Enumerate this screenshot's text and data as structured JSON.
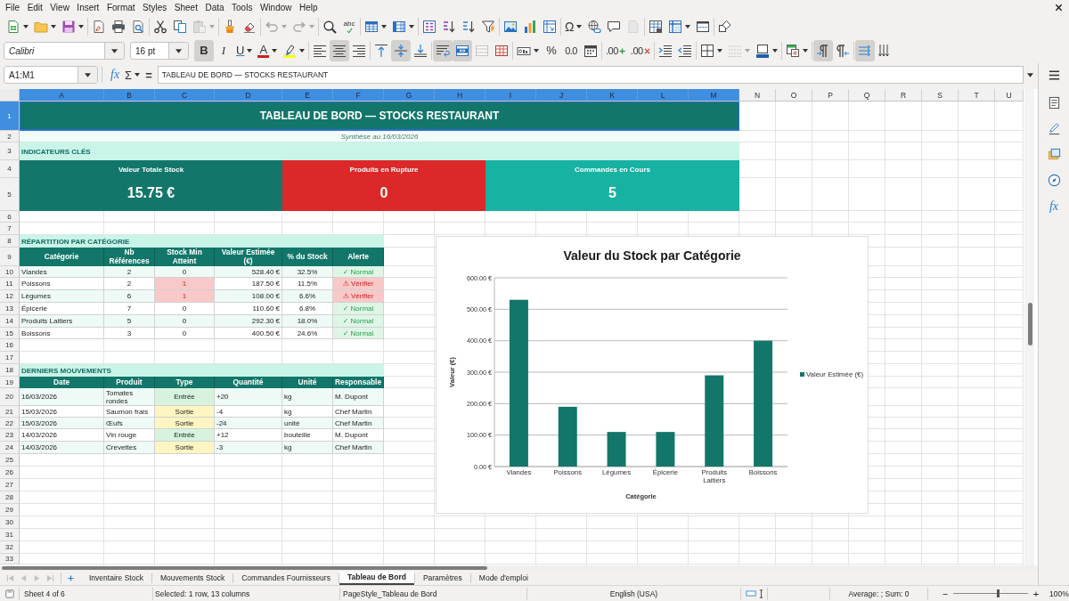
{
  "menu": [
    "File",
    "Edit",
    "View",
    "Insert",
    "Format",
    "Styles",
    "Sheet",
    "Data",
    "Tools",
    "Window",
    "Help"
  ],
  "standard_toolbar": [
    [
      {
        "kind": "new-spreadsheet",
        "dropdown": true,
        "disabled": false
      },
      {
        "kind": "open",
        "dropdown": true,
        "disabled": false
      },
      {
        "kind": "save",
        "dropdown": true,
        "disabled": false
      }
    ],
    [
      {
        "kind": "export-pdf",
        "disabled": false
      },
      {
        "kind": "print",
        "disabled": false
      },
      {
        "kind": "print-preview",
        "disabled": false
      }
    ],
    [
      {
        "kind": "cut",
        "disabled": false
      },
      {
        "kind": "copy",
        "disabled": false
      },
      {
        "kind": "paste",
        "dropdown": true,
        "disabled": true
      }
    ],
    [
      {
        "kind": "clone-formatting",
        "disabled": false
      },
      {
        "kind": "clear-formatting",
        "disabled": false
      }
    ],
    [
      {
        "kind": "undo",
        "dropdown": true,
        "disabled": true
      },
      {
        "kind": "redo",
        "dropdown": true,
        "disabled": true
      }
    ],
    [
      {
        "kind": "find-replace",
        "disabled": false
      },
      {
        "kind": "spelling",
        "label": "abc",
        "disabled": false
      }
    ],
    [
      {
        "kind": "insert-rows",
        "dropdown": true,
        "disabled": false
      },
      {
        "kind": "insert-columns",
        "dropdown": true,
        "disabled": false
      }
    ],
    [
      {
        "kind": "sort",
        "disabled": false
      },
      {
        "kind": "sort-ascending",
        "disabled": false
      },
      {
        "kind": "sort-descending",
        "disabled": false
      },
      {
        "kind": "autofilter",
        "disabled": false
      }
    ],
    [
      {
        "kind": "insert-image",
        "disabled": false
      },
      {
        "kind": "insert-chart",
        "disabled": false
      },
      {
        "kind": "pivot-table",
        "disabled": false
      }
    ],
    [
      {
        "kind": "special-character",
        "label": "Ω",
        "dropdown": true,
        "disabled": false
      },
      {
        "kind": "hyperlink",
        "disabled": false
      },
      {
        "kind": "comment",
        "disabled": false
      },
      {
        "kind": "header-footer",
        "disabled": true
      }
    ],
    [
      {
        "kind": "print-area",
        "disabled": false
      },
      {
        "kind": "freeze-panes",
        "dropdown": true,
        "disabled": false
      },
      {
        "kind": "split-window",
        "disabled": false
      }
    ],
    [
      {
        "kind": "shapes",
        "disabled": false
      }
    ]
  ],
  "format_toolbar": {
    "font_name": "Calibri",
    "font_size": "16 pt",
    "groups": [
      [
        {
          "kind": "bold",
          "label": "B",
          "on": true,
          "disabled": false
        },
        {
          "kind": "italic",
          "label": "I",
          "on": false,
          "disabled": false
        },
        {
          "kind": "underline",
          "label": "U",
          "dropdown": true,
          "on": false,
          "disabled": false
        },
        {
          "kind": "font-color",
          "label": "A",
          "dropdown": true,
          "on": false,
          "disabled": false
        },
        {
          "kind": "highlight",
          "dropdown": true,
          "on": false,
          "disabled": false
        }
      ],
      [
        {
          "kind": "align-left",
          "on": false,
          "disabled": false
        },
        {
          "kind": "align-center",
          "on": true,
          "disabled": false
        },
        {
          "kind": "align-right",
          "on": false,
          "disabled": false
        }
      ],
      [
        {
          "kind": "align-top",
          "on": false,
          "disabled": false
        },
        {
          "kind": "align-middle",
          "on": true,
          "disabled": false
        },
        {
          "kind": "align-bottom",
          "on": false,
          "disabled": false
        }
      ],
      [
        {
          "kind": "wrap-text",
          "on": true,
          "disabled": false
        },
        {
          "kind": "merge-center",
          "on": true,
          "disabled": false
        },
        {
          "kind": "merge-cells",
          "on": false,
          "disabled": true
        },
        {
          "kind": "unmerge-cells",
          "on": false,
          "disabled": false
        }
      ],
      [
        {
          "kind": "currency",
          "dropdown": true,
          "on": false,
          "disabled": false
        },
        {
          "kind": "percent",
          "label": "%",
          "on": false,
          "disabled": false
        },
        {
          "kind": "number",
          "label": "0.0",
          "on": false,
          "disabled": false
        },
        {
          "kind": "date",
          "on": false,
          "disabled": false
        }
      ],
      [
        {
          "kind": "add-decimal",
          "label": ".00",
          "on": false,
          "disabled": false
        },
        {
          "kind": "delete-decimal",
          "label": ".00",
          "on": false,
          "disabled": false
        }
      ],
      [
        {
          "kind": "indent-increase",
          "on": false,
          "disabled": false
        },
        {
          "kind": "indent-decrease",
          "on": false,
          "disabled": false
        }
      ],
      [
        {
          "kind": "borders",
          "dropdown": true,
          "on": false,
          "disabled": false
        },
        {
          "kind": "border-style",
          "dropdown": true,
          "on": false,
          "disabled": true
        },
        {
          "kind": "border-color",
          "dropdown": true,
          "on": false,
          "disabled": false
        }
      ],
      [
        {
          "kind": "conditional",
          "dropdown": true,
          "on": false,
          "disabled": false
        }
      ],
      [
        {
          "kind": "left-to-right",
          "on": true,
          "disabled": false
        },
        {
          "kind": "right-to-left",
          "on": false,
          "disabled": false
        }
      ],
      [
        {
          "kind": "text-left-to-right",
          "on": true,
          "disabled": false
        },
        {
          "kind": "text-top-to-bottom",
          "on": false,
          "disabled": false
        }
      ]
    ]
  },
  "formula_bar": {
    "cell_reference": "A1:M1",
    "function_wizard": "fx",
    "sum": "Σ",
    "equals": "=",
    "content": "TABLEAU DE BORD — STOCKS RESTAURANT"
  },
  "sidebar": [
    {
      "kind": "menu"
    },
    {
      "kind": "properties"
    },
    {
      "kind": "styles"
    },
    {
      "kind": "gallery"
    },
    {
      "kind": "navigator"
    },
    {
      "kind": "functions",
      "label": "fx"
    }
  ],
  "grid": {
    "columns": [
      {
        "label": "A",
        "selected": true
      },
      {
        "label": "B",
        "selected": true
      },
      {
        "label": "C",
        "selected": true
      },
      {
        "label": "D",
        "selected": true
      },
      {
        "label": "E",
        "selected": true
      },
      {
        "label": "F",
        "selected": true
      },
      {
        "label": "G",
        "selected": true
      },
      {
        "label": "H",
        "selected": true
      },
      {
        "label": "I",
        "selected": true
      },
      {
        "label": "J",
        "selected": true
      },
      {
        "label": "K",
        "selected": true
      },
      {
        "label": "L",
        "selected": true
      },
      {
        "label": "M",
        "selected": true
      },
      {
        "label": "N",
        "selected": false
      },
      {
        "label": "O",
        "selected": false
      },
      {
        "label": "P",
        "selected": false
      },
      {
        "label": "Q",
        "selected": false
      },
      {
        "label": "R",
        "selected": false
      },
      {
        "label": "S",
        "selected": false
      },
      {
        "label": "T",
        "selected": false
      },
      {
        "label": "U",
        "selected": false
      }
    ],
    "rows": [
      {
        "label": "1",
        "selected": true
      },
      {
        "label": "2",
        "selected": false
      },
      {
        "label": "3",
        "selected": false
      },
      {
        "label": "4",
        "selected": false
      },
      {
        "label": "5",
        "selected": false
      },
      {
        "label": "6",
        "selected": false
      },
      {
        "label": "7",
        "selected": false
      },
      {
        "label": "8",
        "selected": false
      },
      {
        "label": "9",
        "selected": false
      },
      {
        "label": "10",
        "selected": false
      },
      {
        "label": "11",
        "selected": false
      },
      {
        "label": "12",
        "selected": false
      },
      {
        "label": "13",
        "selected": false
      },
      {
        "label": "14",
        "selected": false
      },
      {
        "label": "15",
        "selected": false
      },
      {
        "label": "16",
        "selected": false
      },
      {
        "label": "17",
        "selected": false
      },
      {
        "label": "18",
        "selected": false
      },
      {
        "label": "19",
        "selected": false
      },
      {
        "label": "20",
        "selected": false
      },
      {
        "label": "21",
        "selected": false
      },
      {
        "label": "22",
        "selected": false
      },
      {
        "label": "23",
        "selected": false
      },
      {
        "label": "24",
        "selected": false
      },
      {
        "label": "25",
        "selected": false
      },
      {
        "label": "26",
        "selected": false
      },
      {
        "label": "27",
        "selected": false
      },
      {
        "label": "28",
        "selected": false
      },
      {
        "label": "29",
        "selected": false
      },
      {
        "label": "30",
        "selected": false
      },
      {
        "label": "31",
        "selected": false
      },
      {
        "label": "32",
        "selected": false
      },
      {
        "label": "33",
        "selected": false
      }
    ]
  },
  "sheet": {
    "title": {
      "text": "TABLEAU DE BORD — STOCKS RESTAURANT",
      "selected": true
    },
    "subtitle": "Synthèse au 16/03/2026",
    "kpi_heading": "INDICATEURS CLÉS",
    "kpis": [
      {
        "label": "Valeur Totale Stock",
        "value": "15.75 €",
        "color": "#13766a"
      },
      {
        "label": "Produits en Rupture",
        "value": "0",
        "color": "#dc2828"
      },
      {
        "label": "Commandes en Cours",
        "value": "5",
        "color": "#17b2a1"
      }
    ],
    "categories": {
      "heading": "RÉPARTITION PAR CATÉGORIE",
      "columns": [
        "Catégorie",
        "Nb Références",
        "Stock Min Atteint",
        "Valeur Estimée (€)",
        "% du Stock",
        "Alerte"
      ],
      "rows": [
        {
          "category": "Viandes",
          "references": "2",
          "stock_min": "0",
          "stock_min_flag": false,
          "value": "528.40 €",
          "share": "32.5%",
          "alert": {
            "kind": "ok",
            "text": "✓ Normal"
          }
        },
        {
          "category": "Poissons",
          "references": "2",
          "stock_min": "1",
          "stock_min_flag": true,
          "value": "187.50 €",
          "share": "11.5%",
          "alert": {
            "kind": "warn",
            "text": "⚠ Vérifier"
          }
        },
        {
          "category": "Légumes",
          "references": "6",
          "stock_min": "1",
          "stock_min_flag": true,
          "value": "108.00 €",
          "share": "6.6%",
          "alert": {
            "kind": "warn",
            "text": "⚠ Vérifier"
          }
        },
        {
          "category": "Épicerie",
          "references": "7",
          "stock_min": "0",
          "stock_min_flag": false,
          "value": "110.60 €",
          "share": "6.8%",
          "alert": {
            "kind": "ok",
            "text": "✓ Normal"
          }
        },
        {
          "category": "Produits Laitiers",
          "references": "5",
          "stock_min": "0",
          "stock_min_flag": false,
          "value": "292.30 €",
          "share": "18.0%",
          "alert": {
            "kind": "ok",
            "text": "✓ Normal"
          }
        },
        {
          "category": "Boissons",
          "references": "3",
          "stock_min": "0",
          "stock_min_flag": false,
          "value": "400.50 €",
          "share": "24.6%",
          "alert": {
            "kind": "ok",
            "text": "✓ Normal"
          }
        }
      ]
    },
    "movements": {
      "heading": "DERNIERS MOUVEMENTS",
      "columns": [
        "Date",
        "Produit",
        "Type",
        "Quantité",
        "Unité",
        "Responsable"
      ],
      "rows": [
        {
          "date": "16/03/2026",
          "product": "Tomates rondes",
          "type": {
            "kind": "in",
            "text": "Entrée"
          },
          "quantity": "+20",
          "unit": "kg",
          "responsible": "M. Dupont"
        },
        {
          "date": "15/03/2026",
          "product": "Saumon frais",
          "type": {
            "kind": "out",
            "text": "Sortie"
          },
          "quantity": "-4",
          "unit": "kg",
          "responsible": "Chef Martin"
        },
        {
          "date": "15/03/2026",
          "product": "Œufs",
          "type": {
            "kind": "out",
            "text": "Sortie"
          },
          "quantity": "-24",
          "unit": "unité",
          "responsible": "Chef Martin"
        },
        {
          "date": "14/03/2026",
          "product": "Vin rouge",
          "type": {
            "kind": "in",
            "text": "Entrée"
          },
          "quantity": "+12",
          "unit": "bouteille",
          "responsible": "M. Dupont"
        },
        {
          "date": "14/03/2026",
          "product": "Crevettes",
          "type": {
            "kind": "out",
            "text": "Sortie"
          },
          "quantity": "-3",
          "unit": "kg",
          "responsible": "Chef Martin"
        }
      ]
    },
    "chart": {
      "chart_data": {
        "type": "bar",
        "title": "Valeur du Stock par Catégorie",
        "xlabel": "Catégorie",
        "ylabel": "Valeur (€)",
        "categories": [
          "Viandes",
          "Poissons",
          "Légumes",
          "Épicerie",
          "Produits Laitiers",
          "Boissons"
        ],
        "series": [
          {
            "name": "Valeur Estimée (€)",
            "color": "#13766a",
            "values": [
              530,
              190,
              110,
              110,
              290,
              400
            ]
          }
        ],
        "ylim": [
          0,
          600
        ],
        "yticks": [
          {
            "value": 0,
            "label": "0.00 €"
          },
          {
            "value": 100,
            "label": "100.00 €"
          },
          {
            "value": 200,
            "label": "200.00 €"
          },
          {
            "value": 300,
            "label": "300.00 €"
          },
          {
            "value": 400,
            "label": "400.00 €"
          },
          {
            "value": 500,
            "label": "500.00 €"
          },
          {
            "value": 600,
            "label": "600.00 €"
          }
        ],
        "grid": true,
        "legend": "right"
      }
    }
  },
  "tab_navigation": [
    {
      "kind": "first",
      "disabled": true
    },
    {
      "kind": "previous",
      "disabled": true
    },
    {
      "kind": "next",
      "disabled": true
    },
    {
      "kind": "last",
      "disabled": true
    }
  ],
  "sheet_tabs": [
    {
      "label": "Inventaire Stock",
      "selected": false
    },
    {
      "label": "Mouvements Stock",
      "selected": false
    },
    {
      "label": "Commandes Fournisseurs",
      "selected": false
    },
    {
      "label": "Tableau de Bord",
      "selected": true
    },
    {
      "label": "Paramètres",
      "selected": false
    },
    {
      "label": "Mode d'emploi",
      "selected": false
    }
  ],
  "status_bar": {
    "sheet": "Sheet 4 of 6",
    "selection": "Selected: 1 row, 13 columns",
    "page_style": "PageStyle_Tableau de Bord",
    "language": "English (USA)",
    "summary": "Average: ; Sum: 0",
    "zoom_out": "−",
    "zoom_slider": {
      "level": 0.6
    },
    "zoom_in": "+",
    "zoom_percent": "100%"
  }
}
